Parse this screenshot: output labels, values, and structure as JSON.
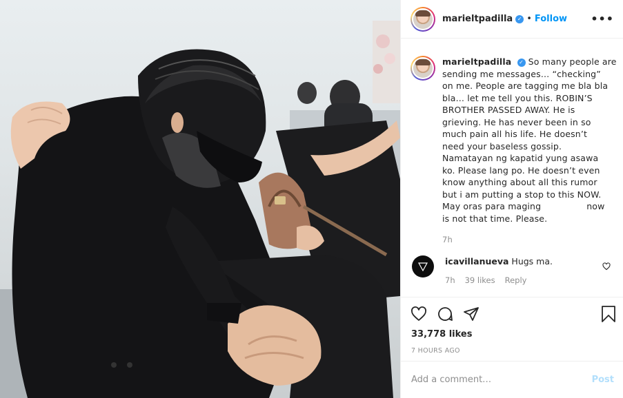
{
  "post": {
    "username": "marieltpadilla",
    "follow_label": "Follow",
    "separator": "•",
    "more_label": "•••",
    "caption": {
      "username": "marieltpadilla",
      "lines": [
        "So many people are",
        "sending me messages… “checking”",
        "on me. People are tagging me bla bla",
        "bla… let me tell you this. ROBIN’S",
        "BROTHER PASSED AWAY. He is",
        "grieving. He has never been in so",
        "much pain all his life. He doesn’t",
        "need your baseless gossip.",
        "Namatayan ng kapatid yung asawa",
        "ko. Please lang po. He doesn’t even",
        "know anything about all this rumor",
        "but i am putting a stop to this NOW.",
        "May oras para maging",
        "is not that time. Please."
      ],
      "line13_tail": "now",
      "time": "7h"
    },
    "comment": {
      "username": "icavillanueva",
      "text": "Hugs ma.",
      "time": "7h",
      "likes": "39 likes",
      "reply_label": "Reply"
    },
    "likes": "33,778 likes",
    "posted_ago": "7 HOURS AGO",
    "add_comment_placeholder": "Add a comment…",
    "post_label": "Post"
  },
  "icons": [
    "heart-icon",
    "comment-icon",
    "share-icon",
    "bookmark-icon",
    "verified-icon",
    "more-icon"
  ],
  "colors": {
    "link_blue": "#0095f6",
    "verified_blue": "#3897f0",
    "muted_text": "#8e8e8e",
    "post_disabled": "#b2dffc"
  }
}
